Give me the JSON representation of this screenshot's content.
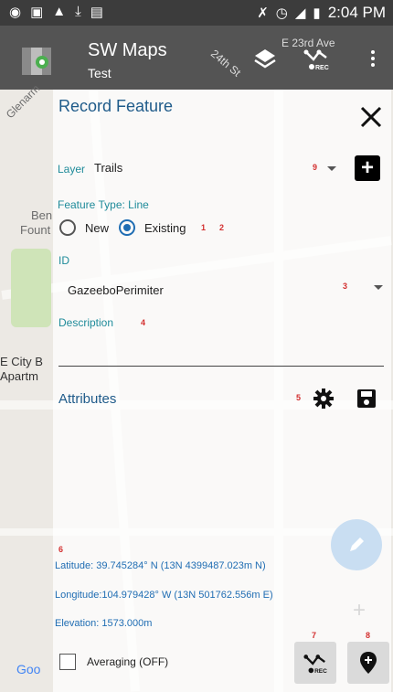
{
  "status_bar": {
    "time": "2:04 PM"
  },
  "app_bar": {
    "title": "SW Maps",
    "subtitle": "Test"
  },
  "map": {
    "labels": [
      "E 23rd Ave",
      "24th St",
      "Glenarm",
      "Ben",
      "Fount",
      "E City B",
      "Apartm",
      "Goo"
    ]
  },
  "panel": {
    "title": "Record Feature",
    "layer_label": "Layer",
    "layer_value": "Trails",
    "feature_type": "Feature Type: Line",
    "radio_new": "New",
    "radio_existing": "Existing",
    "selected": "Existing",
    "id_label": "ID",
    "id_value": "GazeeboPerimiter",
    "description_label": "Description",
    "attributes_label": "Attributes",
    "latitude": "Latitude:  39.745284° N (13N 4399487.023m N)",
    "longitude": "Longitude:104.979428° W (13N 501762.556m E)",
    "elevation": "Elevation:  1573.000m",
    "averaging": "Averaging (OFF)",
    "averaging_checked": false
  },
  "annotations": [
    "1",
    "2",
    "3",
    "4",
    "5",
    "6",
    "7",
    "8",
    "9"
  ],
  "colors": {
    "accent": "#1f6db3",
    "teal": "#1f8b9a",
    "annotation": "#d32f2f",
    "appbar": "#545454"
  }
}
